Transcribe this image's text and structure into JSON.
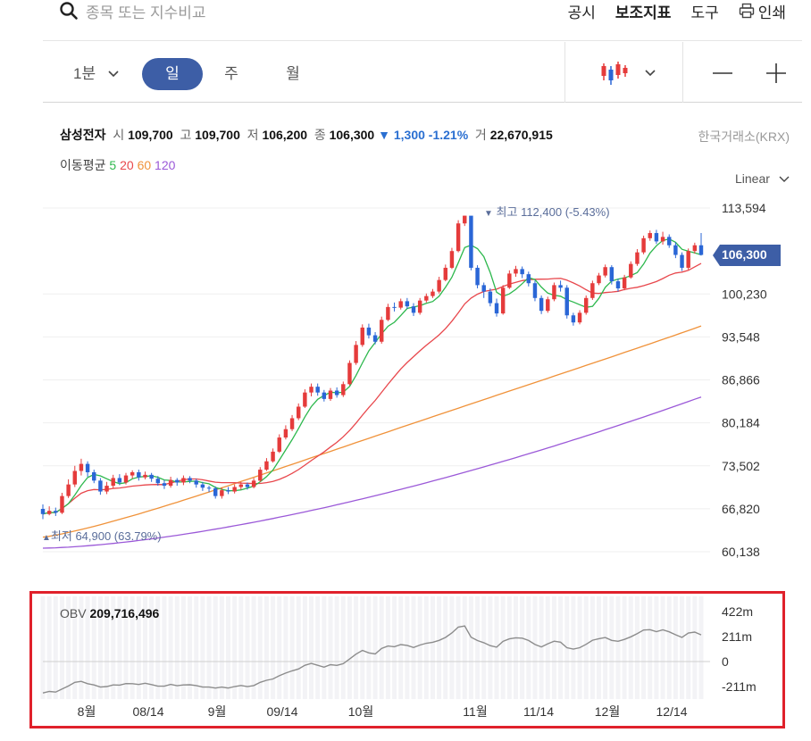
{
  "search": {
    "placeholder": "종목 또는 지수비교"
  },
  "topmenu": {
    "disclosure": "공시",
    "indicators": "보조지표",
    "tools": "도구",
    "print": "인쇄"
  },
  "periods": {
    "minute": "1분",
    "day": "일",
    "week": "주",
    "month": "월"
  },
  "zoom": {
    "minus": "—",
    "plus": "+"
  },
  "stock": {
    "name": "삼성전자",
    "open_label": "시",
    "open": "109,700",
    "high_label": "고",
    "high": "109,700",
    "low_label": "저",
    "low": "106,200",
    "close_label": "종",
    "close": "106,300",
    "change": "▼ 1,300",
    "change_pct": "-1.21%",
    "volume_label": "거",
    "volume": "22,670,915",
    "exchange": "한국거래소(KRX)"
  },
  "ma_legend": {
    "label": "이동평균",
    "items": [
      {
        "period": "5",
        "color": "#2db84d"
      },
      {
        "period": "20",
        "color": "#e8474c"
      },
      {
        "period": "60",
        "color": "#f0923a"
      },
      {
        "period": "120",
        "color": "#9b59d8"
      }
    ]
  },
  "scale": {
    "label": "Linear"
  },
  "y_ticks": [
    "113,594",
    "100,230",
    "93,548",
    "86,866",
    "80,184",
    "73,502",
    "66,820",
    "60,138"
  ],
  "current_price": "106,300",
  "high_marker": "최고 112,400 (-5.43%)",
  "low_marker": "최저 64,900 (63.79%)",
  "obv": {
    "label": "OBV",
    "value": "209,716,496",
    "y_ticks": [
      "422m",
      "211m",
      "0",
      "-211m"
    ]
  },
  "x_ticks": [
    "8월",
    "08/14",
    "9월",
    "09/14",
    "10월",
    "11월",
    "11/14",
    "12월",
    "12/14"
  ],
  "colors": {
    "up": "#e53b3b",
    "down": "#2a66d6",
    "accent": "#3d5ea6",
    "highlight": "#e0212b"
  },
  "chart_data": {
    "type": "candlestick",
    "price_range": [
      60138,
      113594
    ],
    "current": 106300,
    "high": 112400,
    "low": 64900,
    "candles": [
      [
        66800,
        66000,
        67500,
        65200
      ],
      [
        66000,
        66500,
        67200,
        65800
      ],
      [
        66500,
        66200,
        67000,
        65700
      ],
      [
        66200,
        68800,
        69300,
        66000
      ],
      [
        68800,
        70600,
        71400,
        68500
      ],
      [
        70600,
        72700,
        73500,
        70200
      ],
      [
        72700,
        73800,
        74600,
        72000
      ],
      [
        73800,
        72500,
        74200,
        71800
      ],
      [
        72500,
        71200,
        72900,
        70800
      ],
      [
        71200,
        69500,
        71600,
        69000
      ],
      [
        69500,
        70400,
        71000,
        69100
      ],
      [
        70400,
        71600,
        72100,
        70000
      ],
      [
        71600,
        70900,
        72200,
        70500
      ],
      [
        70900,
        72000,
        72400,
        70600
      ],
      [
        72000,
        72500,
        72800,
        71500
      ],
      [
        72500,
        71700,
        72900,
        71200
      ],
      [
        71700,
        72100,
        72600,
        71400
      ],
      [
        72100,
        71500,
        72400,
        71000
      ],
      [
        71500,
        70800,
        71900,
        70400
      ],
      [
        70800,
        70400,
        71300,
        69900
      ],
      [
        70400,
        71300,
        71800,
        70100
      ],
      [
        71300,
        70900,
        71600,
        70400
      ],
      [
        70900,
        71600,
        72000,
        70500
      ],
      [
        71600,
        71200,
        71900,
        70800
      ],
      [
        71200,
        70600,
        71500,
        70100
      ],
      [
        70600,
        70100,
        71000,
        69600
      ],
      [
        70100,
        70000,
        70400,
        69400
      ],
      [
        70000,
        68800,
        70300,
        68400
      ],
      [
        68800,
        69700,
        70100,
        68400
      ],
      [
        69700,
        69500,
        70200,
        69100
      ],
      [
        69500,
        70200,
        70600,
        69200
      ],
      [
        70200,
        70600,
        71000,
        69800
      ],
      [
        70600,
        70200,
        70900,
        69800
      ],
      [
        70200,
        71200,
        71600,
        70000
      ],
      [
        71200,
        72900,
        73300,
        71000
      ],
      [
        72900,
        74200,
        74700,
        72700
      ],
      [
        74200,
        75700,
        76200,
        74000
      ],
      [
        75700,
        77900,
        78400,
        75500
      ],
      [
        77900,
        79200,
        79800,
        77600
      ],
      [
        79200,
        80900,
        81400,
        78900
      ],
      [
        80900,
        82700,
        83200,
        80600
      ],
      [
        82700,
        84900,
        85400,
        82500
      ],
      [
        84900,
        85800,
        86300,
        84300
      ],
      [
        85800,
        84900,
        86300,
        84400
      ],
      [
        84900,
        83900,
        85300,
        83500
      ],
      [
        83900,
        85200,
        85600,
        83600
      ],
      [
        85200,
        84500,
        85700,
        84100
      ],
      [
        84500,
        86200,
        86600,
        84200
      ],
      [
        86200,
        89500,
        89900,
        86000
      ],
      [
        89500,
        92300,
        92900,
        89200
      ],
      [
        92300,
        95000,
        95500,
        92000
      ],
      [
        95000,
        93800,
        95600,
        93300
      ],
      [
        93800,
        92800,
        94300,
        92400
      ],
      [
        92800,
        96200,
        96700,
        92500
      ],
      [
        96200,
        98200,
        98700,
        96000
      ],
      [
        98200,
        98100,
        98900,
        97500
      ],
      [
        98100,
        99100,
        99500,
        97800
      ],
      [
        99100,
        98300,
        99600,
        97900
      ],
      [
        98300,
        97300,
        98800,
        96800
      ],
      [
        97300,
        99200,
        99600,
        97000
      ],
      [
        99200,
        99900,
        100300,
        98900
      ],
      [
        99900,
        100600,
        101000,
        99600
      ],
      [
        100600,
        102400,
        102900,
        100300
      ],
      [
        102400,
        104300,
        104800,
        102200
      ],
      [
        104300,
        106900,
        107400,
        104100
      ],
      [
        106900,
        111200,
        111700,
        106700
      ],
      [
        111200,
        112400,
        112400,
        110800
      ],
      [
        112400,
        104300,
        112000,
        103900
      ],
      [
        104300,
        101600,
        104700,
        101100
      ],
      [
        101600,
        100600,
        102000,
        99600
      ],
      [
        100600,
        98800,
        101100,
        98300
      ],
      [
        98800,
        97200,
        99500,
        96700
      ],
      [
        97200,
        101200,
        101600,
        97000
      ],
      [
        101200,
        103400,
        103900,
        101000
      ],
      [
        103400,
        104100,
        104600,
        102900
      ],
      [
        104100,
        103300,
        104500,
        102700
      ],
      [
        103300,
        101900,
        103700,
        101400
      ],
      [
        101900,
        99600,
        102300,
        99100
      ],
      [
        99600,
        97600,
        100000,
        97100
      ],
      [
        97600,
        99400,
        99800,
        97300
      ],
      [
        99400,
        101600,
        102000,
        99100
      ],
      [
        101600,
        101200,
        102300,
        100600
      ],
      [
        101200,
        96900,
        101600,
        96400
      ],
      [
        96900,
        95800,
        97300,
        95300
      ],
      [
        95800,
        97300,
        97700,
        95500
      ],
      [
        97300,
        99600,
        100000,
        97000
      ],
      [
        99600,
        101900,
        102300,
        99300
      ],
      [
        101900,
        103100,
        103500,
        101600
      ],
      [
        103100,
        104400,
        104800,
        102800
      ],
      [
        104400,
        102200,
        104700,
        101700
      ],
      [
        102200,
        101100,
        102600,
        100600
      ],
      [
        101100,
        102800,
        103200,
        100800
      ],
      [
        102800,
        104900,
        105300,
        102600
      ],
      [
        104900,
        106700,
        107200,
        104600
      ],
      [
        106700,
        108900,
        109300,
        106400
      ],
      [
        108900,
        109700,
        110100,
        108500
      ],
      [
        109700,
        108400,
        110200,
        108000
      ],
      [
        108400,
        109100,
        109900,
        107900
      ],
      [
        109100,
        107800,
        109500,
        107400
      ],
      [
        107800,
        106300,
        108300,
        105800
      ],
      [
        106300,
        104300,
        106700,
        103800
      ],
      [
        104300,
        106900,
        107300,
        104000
      ],
      [
        106900,
        107800,
        108200,
        106500
      ],
      [
        107800,
        106300,
        109700,
        106200
      ]
    ]
  }
}
